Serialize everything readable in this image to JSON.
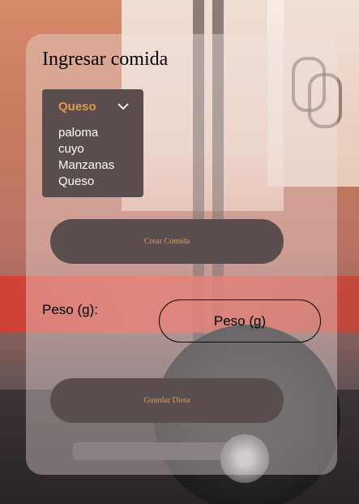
{
  "form": {
    "title": "Ingresar comida",
    "food_select": {
      "selected": "Queso",
      "options": [
        "paloma",
        "cuyo",
        "Manzanas",
        "Queso"
      ]
    },
    "create_button_label": "Crear Comida",
    "weight_label": "Peso (g):",
    "weight_placeholder": "Peso (g)",
    "save_button_label": "Guardar Dieta"
  },
  "colors": {
    "button_bg": "#594d4d",
    "button_text": "#e39a4d",
    "select_option_text": "#ffffff"
  }
}
